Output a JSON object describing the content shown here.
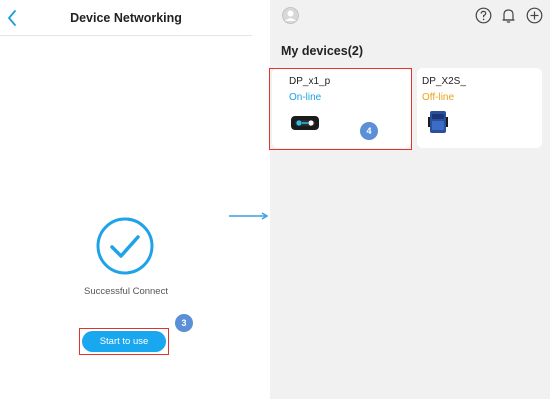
{
  "left_screen": {
    "title": "Device Networking",
    "status_text": "Successful Connect",
    "start_button_label": "Start to use",
    "step_number": "3"
  },
  "right_screen": {
    "section_title": "My devices(2)",
    "devices": [
      {
        "name": "DP_x1_p",
        "status": "On-line",
        "status_color": "#1aa1e0",
        "image": "controller-icon"
      },
      {
        "name": "DP_X2S_",
        "status": "Off-line",
        "status_color": "#e8a317",
        "image": "device-unit-icon"
      }
    ],
    "step_number": "4",
    "icons": [
      "avatar-icon",
      "help-icon",
      "bell-icon",
      "add-icon"
    ]
  },
  "colors": {
    "accent_blue": "#19a7f0",
    "highlight_red": "#e2342d",
    "badge_blue": "#5b8fd6",
    "online": "#1aa1e0",
    "offline": "#e8a317"
  }
}
